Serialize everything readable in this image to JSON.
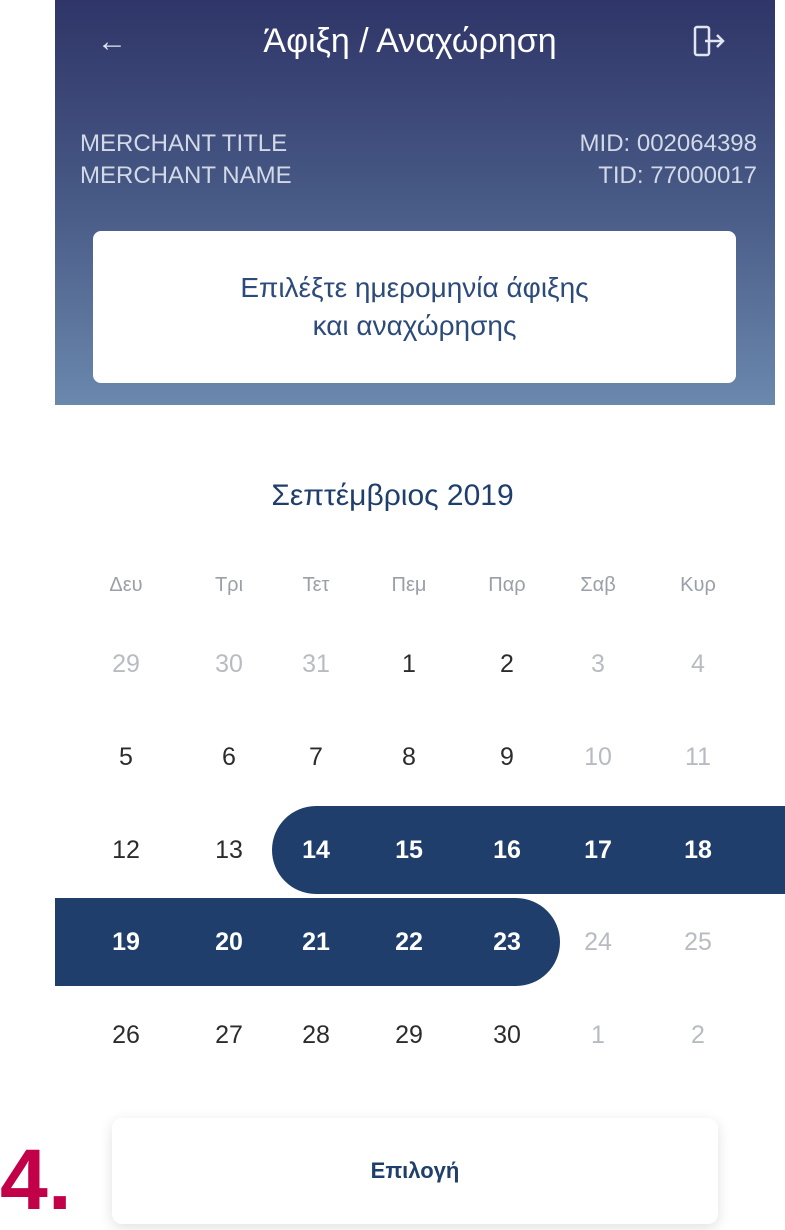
{
  "header": {
    "title": "Άφιξη / Αναχώρηση",
    "back_icon": "arrow-left-icon",
    "logout_icon": "logout-door-icon",
    "merchant_title": "MERCHANT TITLE",
    "merchant_name": "MERCHANT NAME",
    "mid": "MID: 002064398",
    "tid": "TID: 77000017"
  },
  "prompt": {
    "line1": "Επιλέξτε ημερομηνία άφιξης",
    "line2": "και αναχώρησης"
  },
  "calendar": {
    "month_label": "Σεπτέμβριος 2019",
    "weekdays": [
      "Δευ",
      "Τρι",
      "Τετ",
      "Πεμ",
      "Παρ",
      "Σαβ",
      "Κυρ"
    ],
    "weeks": [
      [
        {
          "d": "29",
          "s": "muted"
        },
        {
          "d": "30",
          "s": "muted"
        },
        {
          "d": "31",
          "s": "muted"
        },
        {
          "d": "1",
          "s": "normal"
        },
        {
          "d": "2",
          "s": "normal"
        },
        {
          "d": "3",
          "s": "muted"
        },
        {
          "d": "4",
          "s": "muted"
        }
      ],
      [
        {
          "d": "5",
          "s": "normal"
        },
        {
          "d": "6",
          "s": "normal"
        },
        {
          "d": "7",
          "s": "normal"
        },
        {
          "d": "8",
          "s": "normal"
        },
        {
          "d": "9",
          "s": "normal"
        },
        {
          "d": "10",
          "s": "muted"
        },
        {
          "d": "11",
          "s": "muted"
        }
      ],
      [
        {
          "d": "12",
          "s": "normal"
        },
        {
          "d": "13",
          "s": "normal"
        },
        {
          "d": "14",
          "s": "selected"
        },
        {
          "d": "15",
          "s": "selected"
        },
        {
          "d": "16",
          "s": "selected"
        },
        {
          "d": "17",
          "s": "selected"
        },
        {
          "d": "18",
          "s": "selected"
        }
      ],
      [
        {
          "d": "19",
          "s": "selected"
        },
        {
          "d": "20",
          "s": "selected"
        },
        {
          "d": "21",
          "s": "selected"
        },
        {
          "d": "22",
          "s": "selected"
        },
        {
          "d": "23",
          "s": "selected"
        },
        {
          "d": "24",
          "s": "muted"
        },
        {
          "d": "25",
          "s": "muted"
        }
      ],
      [
        {
          "d": "26",
          "s": "normal"
        },
        {
          "d": "27",
          "s": "normal"
        },
        {
          "d": "28",
          "s": "normal"
        },
        {
          "d": "29",
          "s": "normal"
        },
        {
          "d": "30",
          "s": "normal"
        },
        {
          "d": "1",
          "s": "muted"
        },
        {
          "d": "2",
          "s": "muted"
        }
      ]
    ],
    "selection": {
      "start": "14",
      "end": "23"
    },
    "accent_color": "#1f3e6c"
  },
  "actions": {
    "select_label": "Επιλογή"
  },
  "step_label": "4."
}
